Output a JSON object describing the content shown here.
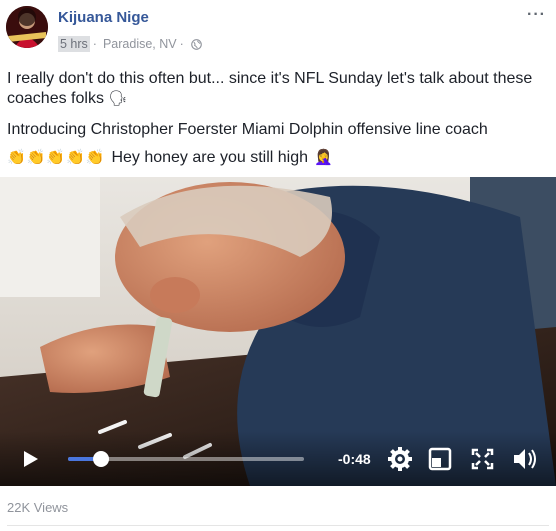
{
  "post": {
    "author": "Kijuana Nige",
    "time": "5 hrs",
    "location": "Paradise, NV",
    "separator": "·",
    "more_label": "···",
    "line1": "I really don't do this often but... since it's NFL Sunday let's talk about these coaches folks",
    "line1_emoji": "🗣",
    "line2": "Introducing Christopher Foerster Miami Dolphin offensive line coach",
    "line3_claps": [
      "👏",
      "👏",
      "👏",
      "👏",
      "👏"
    ],
    "line3_text": "Hey honey are you still high",
    "line3_emoji": "🤦‍♀️"
  },
  "video": {
    "remaining_time": "-0:48",
    "progress": 0.14,
    "controls": [
      "play-icon",
      "settings-icon",
      "pip-icon",
      "fullscreen-icon",
      "volume-icon"
    ]
  },
  "stats": {
    "views": "22K Views"
  }
}
